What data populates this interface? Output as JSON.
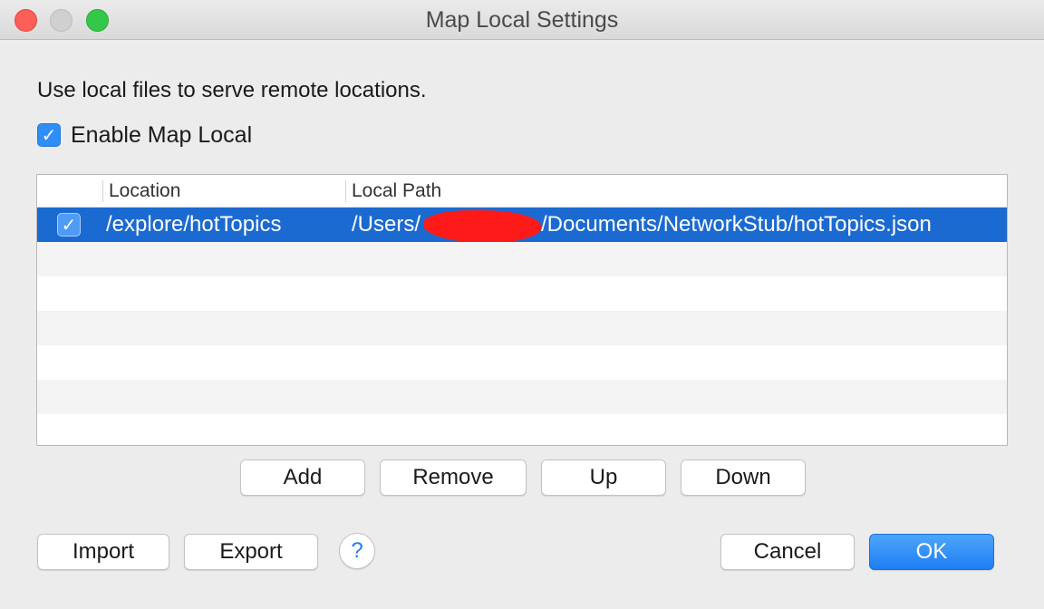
{
  "window": {
    "title": "Map Local Settings"
  },
  "description": "Use local files to serve remote locations.",
  "enable": {
    "label": "Enable Map Local",
    "checked": true,
    "check_glyph": "✓"
  },
  "table": {
    "columns": [
      "",
      "Location",
      "Local Path"
    ],
    "rows": [
      {
        "enabled": true,
        "check_glyph": "✓",
        "location": "/explore/hotTopics",
        "path_prefix": "/Users/",
        "path_suffix": "/Documents/NetworkStub/hotTopics.json",
        "selected": true
      }
    ]
  },
  "buttons": {
    "add": "Add",
    "remove": "Remove",
    "up": "Up",
    "down": "Down",
    "import": "Import",
    "export": "Export",
    "help": "?",
    "cancel": "Cancel",
    "ok": "OK"
  },
  "colors": {
    "accent": "#2f8ef6",
    "selection": "#1b6ad1",
    "close": "#fc5f57",
    "maximize": "#34c84a",
    "redaction": "#ff1a1a"
  }
}
